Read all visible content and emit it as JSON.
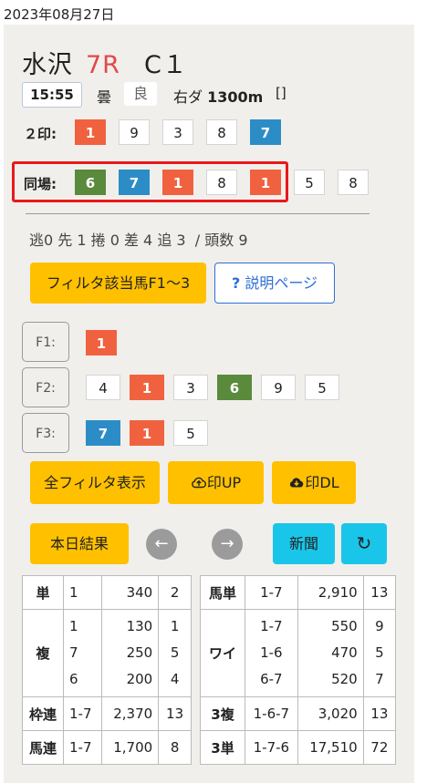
{
  "date": "2023年08月27日",
  "race": {
    "venue": "水沢",
    "race_no": "7R",
    "class": "C１"
  },
  "time": "15:55",
  "weather": "曇",
  "condition": "良",
  "course": {
    "prefix": "右ダ",
    "distance": "1300m"
  },
  "brackets": "[]",
  "mark2": {
    "label": "２印:",
    "nums": [
      "1",
      "9",
      "3",
      "8",
      "7"
    ]
  },
  "same": {
    "label": "同場:",
    "nums": [
      "6",
      "7",
      "1",
      "8",
      "1",
      "5",
      "8"
    ]
  },
  "stats": {
    "text": "逃0 先 1  捲 0  差 4  追 3",
    "head": "/ 頭数 9"
  },
  "buttons": {
    "filter": "フィルタ該当馬F1～3",
    "help_icon": "?",
    "help": "説明ページ",
    "all_filter": "全フィルタ表示",
    "mark_up": "印UP",
    "mark_dl": "印DL",
    "today": "本日結果",
    "prev": "←",
    "next": "→",
    "news": "新聞",
    "refresh": "↻"
  },
  "filters": [
    {
      "label": "F1:",
      "nums": [
        "1"
      ]
    },
    {
      "label": "F2:",
      "nums": [
        "4",
        "1",
        "3",
        "6",
        "9",
        "5"
      ]
    },
    {
      "label": "F3:",
      "nums": [
        "7",
        "1",
        "5"
      ]
    }
  ],
  "colors": {
    "red": "#f0623f",
    "blue": "#2c8dc6",
    "green": "#5a8a3c",
    "yellow": "#ffc000",
    "cyan": "#19c6e9"
  },
  "results_left": {
    "tan": {
      "label": "単",
      "combo": "1",
      "pay": "340",
      "pop": "2"
    },
    "fuku": {
      "label": "複",
      "combos": [
        "1",
        "7",
        "6"
      ],
      "pays": [
        "130",
        "250",
        "200"
      ],
      "pops": [
        "1",
        "5",
        "4"
      ]
    },
    "wakuren": {
      "label": "枠連",
      "combo": "1-7",
      "pay": "2,370",
      "pop": "13"
    },
    "umaren": {
      "label": "馬連",
      "combo": "1-7",
      "pay": "1,700",
      "pop": "8"
    }
  },
  "results_right": {
    "umatan": {
      "label": "馬単",
      "combo": "1-7",
      "pay": "2,910",
      "pop": "13"
    },
    "wide": {
      "label": "ワイ",
      "combos": [
        "1-7",
        "1-6",
        "6-7"
      ],
      "pays": [
        "550",
        "470",
        "520"
      ],
      "pops": [
        "9",
        "5",
        "7"
      ]
    },
    "sanfuku": {
      "label": "3複",
      "combo": "1-6-7",
      "pay": "3,020",
      "pop": "13"
    },
    "santan": {
      "label": "3単",
      "combo": "1-7-6",
      "pay": "17,510",
      "pop": "72"
    }
  }
}
